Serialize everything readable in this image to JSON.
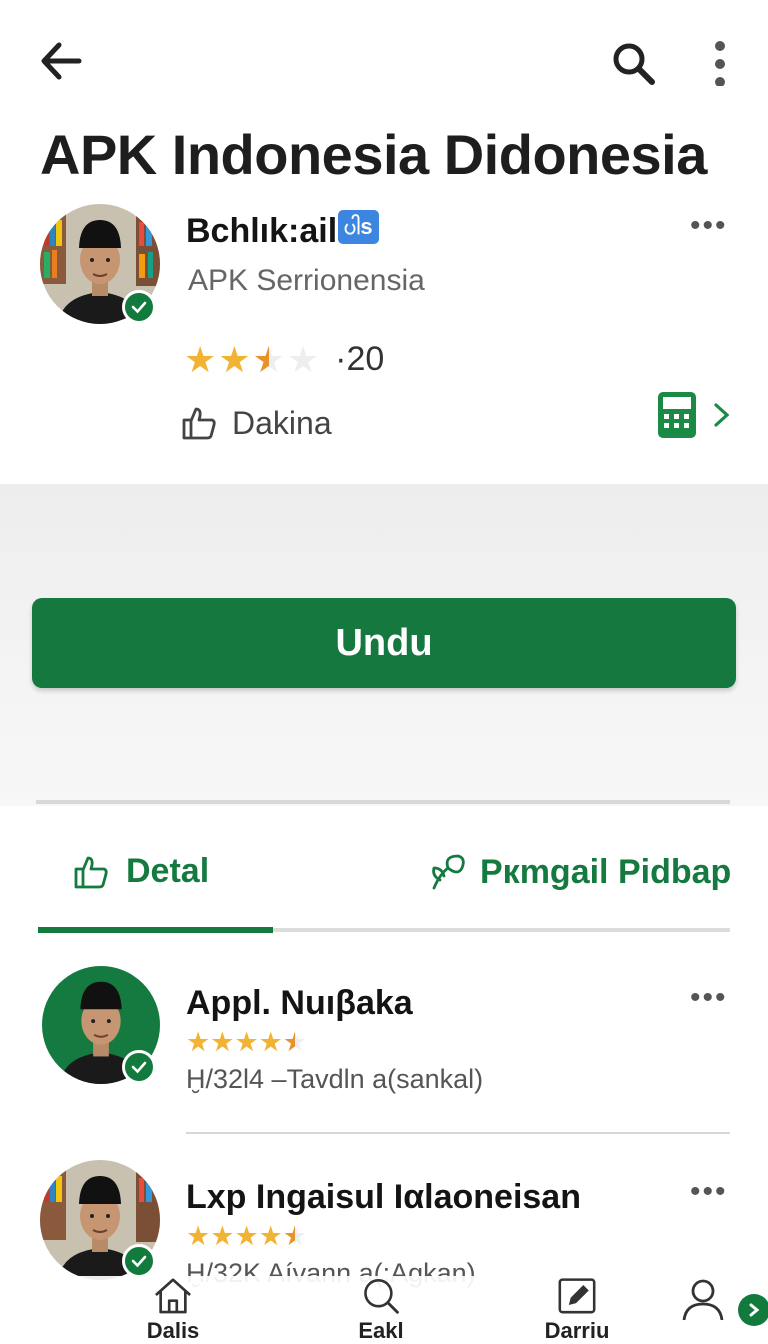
{
  "header": {
    "title": "APK Indonesia Didonesia",
    "icons": [
      "back-arrow-icon",
      "search-icon",
      "more-vertical-icon"
    ]
  },
  "developer": {
    "name": "Bchlık:ail",
    "badge": "ပါs",
    "subtitle": "APK Serrionensia",
    "rating_value": 2.5,
    "rating_count": "·20",
    "like_label": "Dakina",
    "verified": true
  },
  "download": {
    "label": "Undu"
  },
  "tabs": [
    {
      "label": "Detal",
      "icon": "like-icon",
      "active": true
    },
    {
      "label": "Pкmgail Pidbap",
      "icon": "sprout-icon",
      "active": false
    }
  ],
  "list": [
    {
      "title": "Appl. Nuıβaka",
      "stars": 4.5,
      "meta": "Ḫ/32l4 –Tavdln a(sankal)",
      "verified": true
    },
    {
      "title": "Lxp Ingaisul Iαlaoneisan",
      "stars": 4.5,
      "meta": "Ḫ/32K Aívann a(:Agkan)",
      "verified": true
    }
  ],
  "bottom_nav": [
    {
      "label": "Dalis",
      "icon": "home-icon"
    },
    {
      "label": "Eakl",
      "icon": "search-icon"
    },
    {
      "label": "Darriu",
      "icon": "edit-icon"
    },
    {
      "label": "",
      "icon": "profile-icon"
    }
  ],
  "colors": {
    "accent": "#14783f",
    "badge": "#3c86e0",
    "star": "#f2b233",
    "text": "#1c1c1c"
  }
}
